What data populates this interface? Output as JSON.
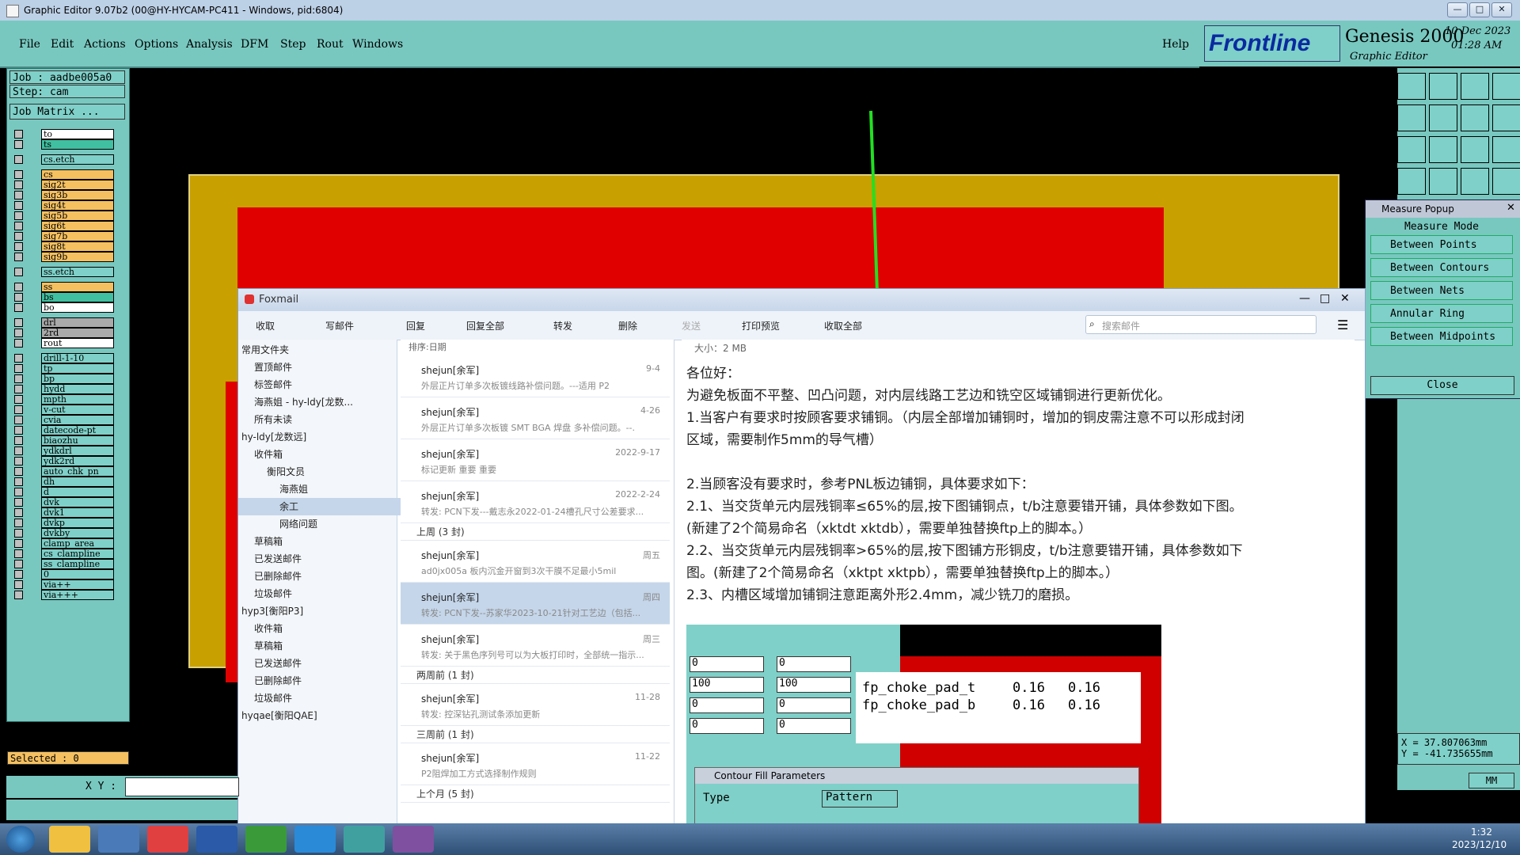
{
  "window": {
    "title": "Graphic Editor 9.07b2 (00@HY-HYCAM-PC411 - Windows, pid:6804)"
  },
  "menu": [
    "File",
    "Edit",
    "Actions",
    "Options",
    "Analysis",
    "DFM",
    "Step",
    "Rout",
    "Windows"
  ],
  "help": "Help",
  "brand": {
    "logo": "Frontline",
    "product": "Genesis 2000",
    "sub": "Graphic Editor",
    "date": "10 Dec 2023",
    "time": "01:28 AM"
  },
  "job": {
    "job": "Job : aadbe005a0",
    "step": "Step: cam",
    "matrix": "Job Matrix ..."
  },
  "layers": [
    "to",
    "ts",
    "cs.etch",
    "cs",
    "sig2t",
    "sig3b",
    "sig4t",
    "sig5b",
    "sig6t",
    "sig7b",
    "sig8t",
    "sig9b",
    "ss.etch",
    "ss",
    "bs",
    "bo",
    "drl",
    "2rd",
    "rout",
    "drill-1-10",
    "tp",
    "bp",
    "hydd",
    "mpth",
    "v-cut",
    "cvia",
    "datecode-pt",
    "biaozhu",
    "ydkdrl",
    "ydk2rd",
    "auto_chk_pn",
    "dh",
    "d",
    "dvk",
    "dvk1",
    "dvkp",
    "dvkby",
    "clamp_area",
    "cs_clampline",
    "ss_clampline",
    "0",
    "via++",
    "via+++"
  ],
  "status": {
    "selected": "Selected : 0",
    "xy_label": "X Y :",
    "coord_x": "X = 37.807063mm",
    "coord_y": "Y = -41.735655mm",
    "units": "MM"
  },
  "measure": {
    "title": "Measure Popup",
    "mode": "Measure Mode",
    "options": [
      "Between Points",
      "Between Contours",
      "Between Nets",
      "Annular Ring",
      "Between Midpoints"
    ],
    "close": "Close"
  },
  "foxmail": {
    "title": "Foxmail",
    "toolbar": [
      "收取",
      "写邮件",
      "回复",
      "回复全部",
      "转发",
      "删除",
      "发送",
      "打印预览",
      "收取全部"
    ],
    "search_placeholder": "搜索邮件",
    "sort": "排序:日期",
    "folders": [
      "常用文件夹",
      "置顶邮件",
      "标签邮件",
      "海燕姐 - hy-ldy[龙数...",
      "所有未读",
      "hy-ldy[龙数远]",
      "收件箱",
      "衡阳文员",
      "海燕姐",
      "余工",
      "网络问题",
      "草稿箱",
      "已发送邮件",
      "已删除邮件",
      "垃圾邮件",
      "hyp3[衡阳P3]",
      "收件箱",
      "草稿箱",
      "已发送邮件",
      "已删除邮件",
      "垃圾邮件",
      "hyqae[衡阳QAE]"
    ],
    "mails": [
      {
        "from": "shejun[余军]",
        "date": "9-4",
        "subject": "外层正片订单多次板镀线路补偿问题。---适用 P2"
      },
      {
        "from": "shejun[余军]",
        "date": "4-26",
        "subject": "外层正片订单多次板镀 SMT BGA 焊盘 多补偿问题。--."
      },
      {
        "from": "shejun[余军]",
        "date": "2022-9-17",
        "subject": "标记更新 重要 重要"
      },
      {
        "from": "shejun[余军]",
        "date": "2022-2-24",
        "subject": "转发: PCN下发---戴志永2022-01-24槽孔尺寸公差要求..."
      },
      {
        "group": "上周 (3 封)"
      },
      {
        "from": "shejun[余军]",
        "date": "周五",
        "subject": "ad0jx005a 板内沉金开窗到3次干膜不足最小5mil"
      },
      {
        "from": "shejun[余军]",
        "date": "周四",
        "subject": "转发: PCN下发--苏家华2023-10-21针对工艺边（包括..."
      },
      {
        "from": "shejun[余军]",
        "date": "周三",
        "subject": "转发: 关于黑色序列号可以为大板打印时，全部统一指示..."
      },
      {
        "group": "两周前 (1 封)"
      },
      {
        "from": "shejun[余军]",
        "date": "11-28",
        "subject": "转发: 控深钻孔测试条添加更新"
      },
      {
        "group": "三周前 (1 封)"
      },
      {
        "from": "shejun[余军]",
        "date": "11-22",
        "subject": "P2阻焊加工方式选择制作规则"
      },
      {
        "group": "上个月 (5 封)"
      }
    ],
    "body": {
      "size": "大小：2 MB",
      "lines": [
        "各位好：",
        "        为避免板面不平整、凹凸问题，对内层线路工艺边和铣空区域铺铜进行更新优化。",
        "1.当客户有要求时按顾客要求铺铜。（内层全部增加铺铜时，增加的铜皮需注意不可以形成封闭",
        "区域，需要制作5mm的导气槽）",
        "",
        "2.当顾客没有要求时，参考PNL板边铺铜，具体要求如下：",
        "   2.1、当交货单元内层残铜率≤65%的层,按下图铺铜点，t/b注意要错开铺，具体参数如下图。",
        "(新建了2个简易命名（xktdt xktdb），需要单独替换ftp上的脚本。）",
        "   2.2、当交货单元内层残铜率>65%的层,按下图铺方形铜皮，t/b注意要错开铺，具体参数如下",
        "图。(新建了2个简易命名（xktpt xktpb），需要单独替换ftp上的脚本。）",
        "   2.3、内槽区域增加铺铜注意距离外形2.4mm，减少铣刀的磨损。"
      ],
      "params": [
        [
          "fp_choke_pad_t",
          "0.16",
          "0.16"
        ],
        [
          "fp_choke_pad_b",
          "0.16",
          "0.16"
        ]
      ],
      "fields": [
        "0",
        "100",
        "0",
        "0",
        "0",
        "100",
        "0",
        "0"
      ],
      "contour_title": "Contour Fill Parameters",
      "type_label": "Type",
      "type_value": "Pattern"
    }
  },
  "taskbar": {
    "time": "1:32",
    "date": "2023/12/10"
  }
}
